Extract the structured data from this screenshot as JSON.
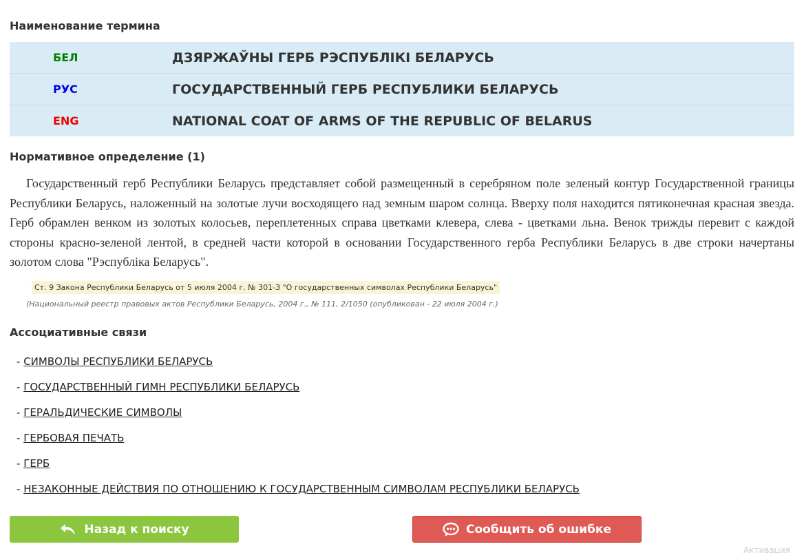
{
  "sections": {
    "term_title": "Наименование термина",
    "definition_title": "Нормативное определение (1)",
    "assoc_title": "Ассоциативные связи"
  },
  "terms": [
    {
      "lang": "БЕЛ",
      "lang_color": "#008000",
      "text": "ДЗЯРЖАЎНЫ ГЕРБ РЭСПУБЛІКІ БЕЛАРУСЬ"
    },
    {
      "lang": "РУС",
      "lang_color": "#0000ee",
      "text": "ГОСУДАРСТВЕННЫЙ ГЕРБ РЕСПУБЛИКИ БЕЛАРУСЬ"
    },
    {
      "lang": "ENG",
      "lang_color": "#ee0000",
      "text": "NATIONAL COAT OF ARMS OF THE REPUBLIC OF BELARUS"
    }
  ],
  "definition": {
    "text": "Государственный герб Республики Беларусь представляет собой размещенный в серебряном поле зеленый контур Государственной границы Республики Беларусь, наложенный на золотые лучи восходящего над земным шаром солнца. Вверху поля находится пятиконечная красная звезда. Герб обрамлен венком из золотых колосьев, переплетенных справа цветками клевера, слева - цветками льна. Венок трижды перевит с каждой стороны красно-зеленой лентой, в средней части которой в основании Государственного герба Республики Беларусь в две строки начертаны золотом слова \"Рэспубліка Беларусь\".",
    "source": "Ст. 9 Закона Республики Беларусь от 5 июля 2004 г. № 301-З \"О государственных символах Республики Беларусь\"",
    "publication": "(Национальный реестр правовых актов Республики Беларусь, 2004 г., № 111, 2/1050 (опубликован - 22 июля 2004 г.)"
  },
  "associations": [
    {
      "dash": "- ",
      "label": "СИМВОЛЫ РЕСПУБЛИКИ БЕЛАРУСЬ"
    },
    {
      "dash": "- ",
      "label": "ГОСУДАРСТВЕННЫЙ ГИМН РЕСПУБЛИКИ БЕЛАРУСЬ"
    },
    {
      "dash": "- ",
      "label": "ГЕРАЛЬДИЧЕСКИЕ СИМВОЛЫ"
    },
    {
      "dash": "- ",
      "label": "ГЕРБОВАЯ ПЕЧАТЬ"
    },
    {
      "dash": "- ",
      "label": "ГЕРБ"
    },
    {
      "dash": "- ",
      "label": "НЕЗАКОННЫЕ ДЕЙСТВИЯ ПО ОТНОШЕНИЮ К ГОСУДАРСТВЕННЫМ СИМВОЛАМ РЕСПУБЛИКИ БЕЛАРУСЬ"
    }
  ],
  "buttons": {
    "back_label": "Назад к поиску",
    "back_icon": "reply-all-icon",
    "back_color": "#8cc63f",
    "report_label": "Сообщить об ошибке",
    "report_icon": "chat-bubble-icon",
    "report_color": "#e05a55"
  },
  "corner_text": "Активация"
}
